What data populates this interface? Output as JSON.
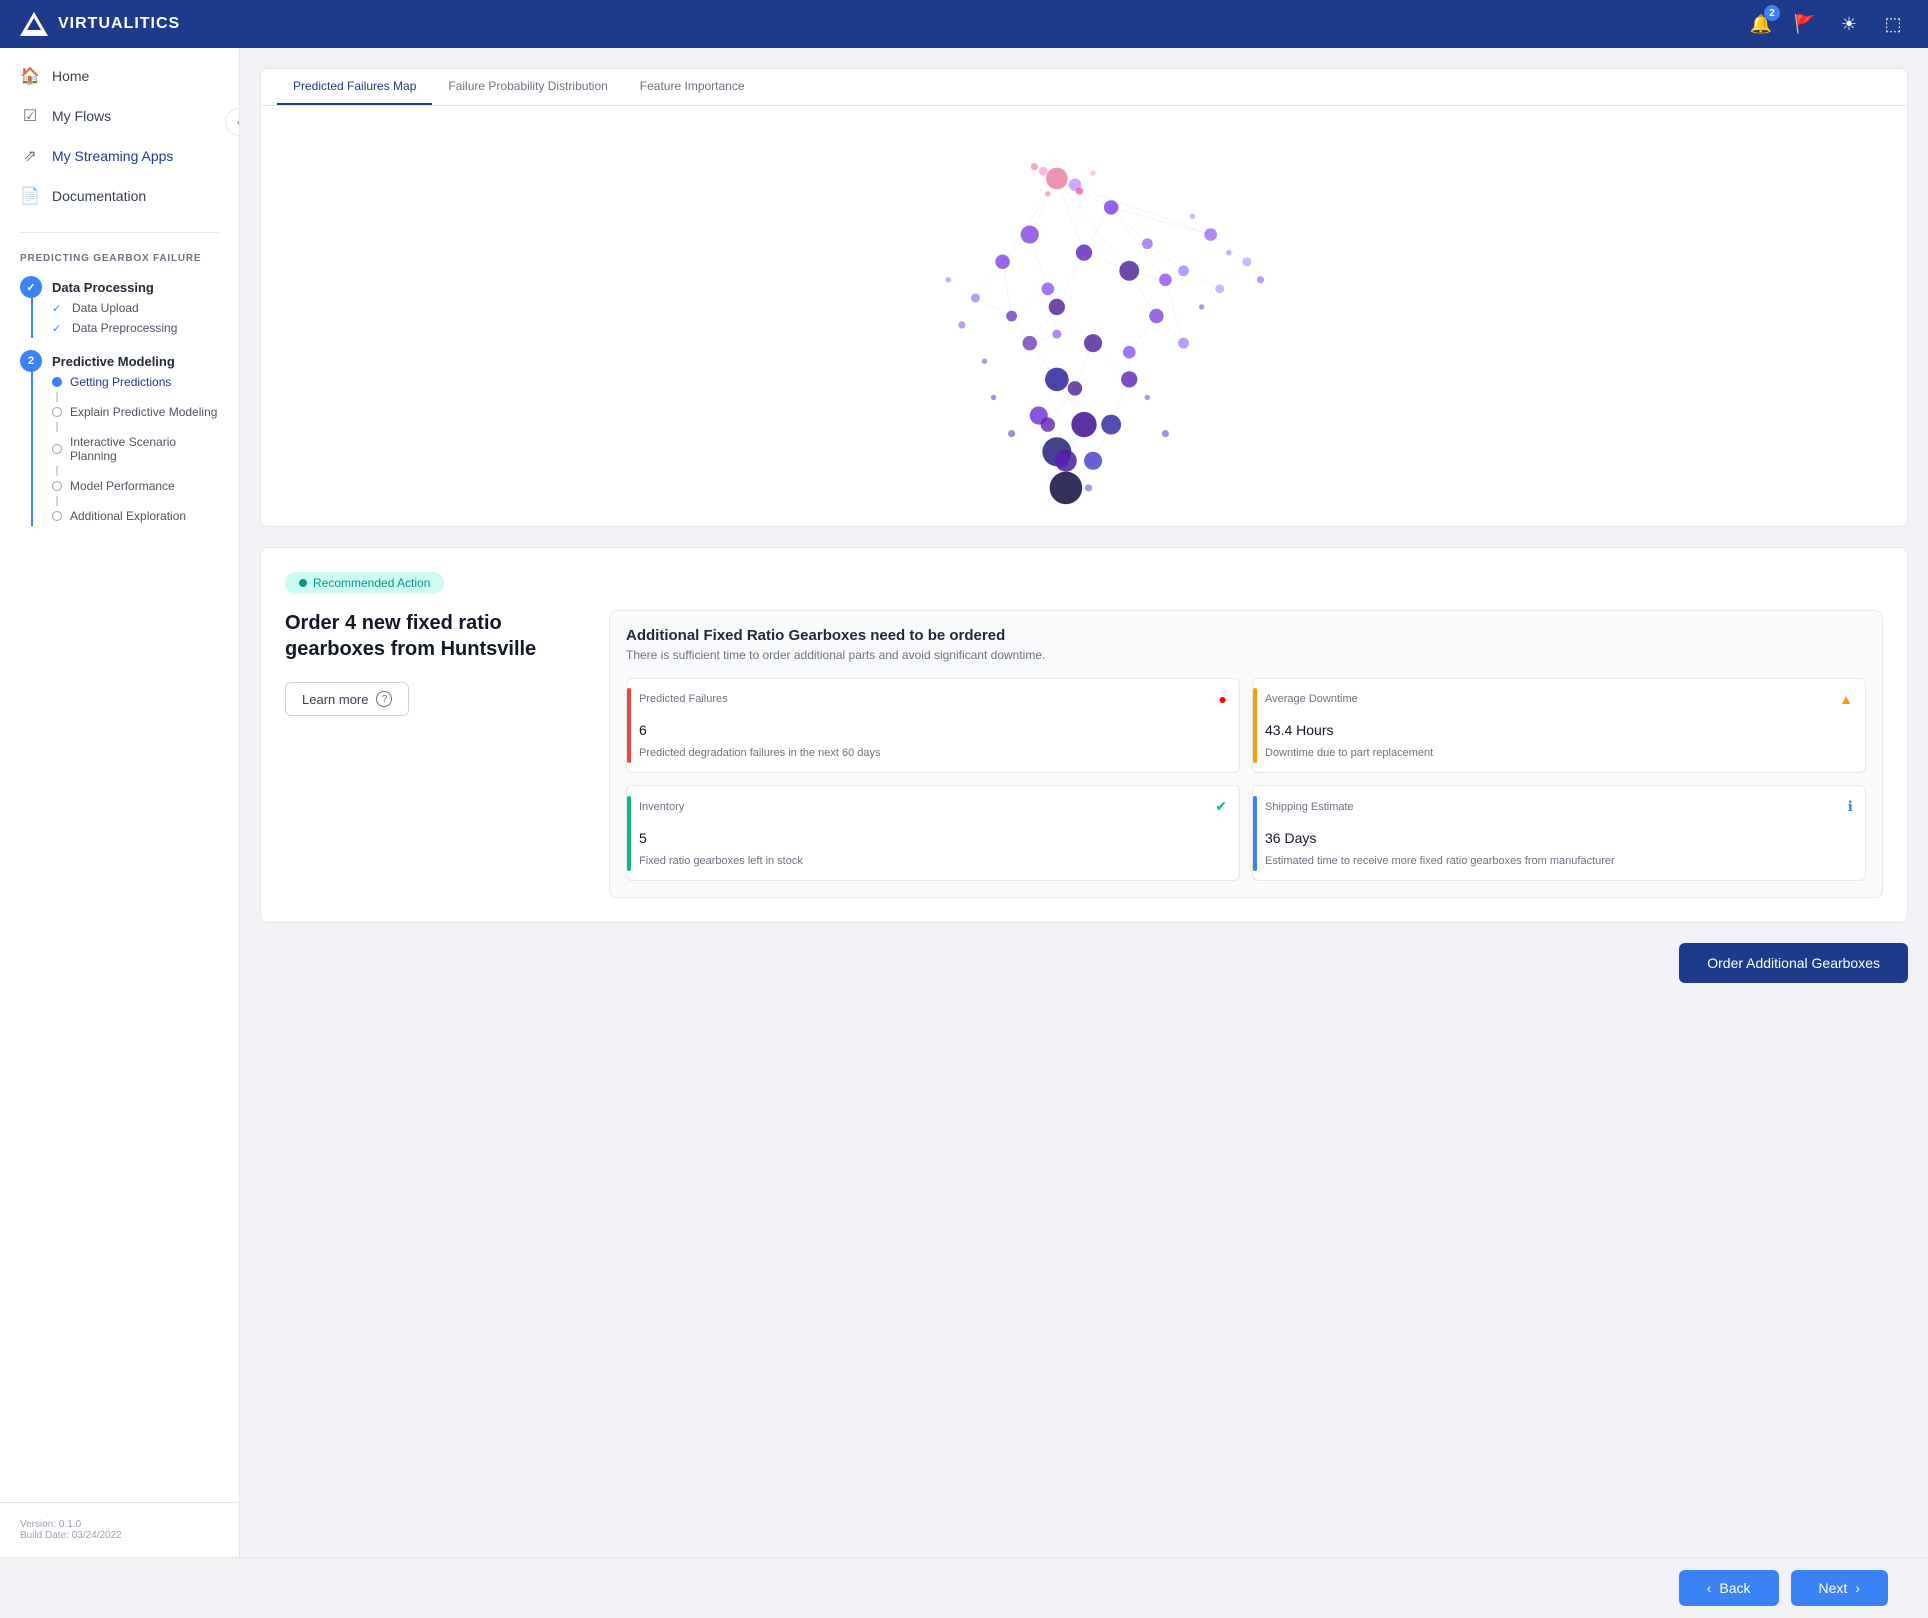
{
  "app": {
    "name": "VIRTUALITICS",
    "logo_alt": "Virtualitics logo"
  },
  "top_nav": {
    "notification_count": "2",
    "icons": [
      "bell",
      "flag",
      "theme",
      "logout"
    ]
  },
  "sidebar": {
    "nav_items": [
      {
        "label": "Home",
        "icon": "🏠",
        "active": false
      },
      {
        "label": "My Flows",
        "icon": "✔",
        "active": false
      },
      {
        "label": "My Streaming Apps",
        "icon": "↗",
        "active": true
      },
      {
        "label": "Documentation",
        "icon": "📄",
        "active": false
      }
    ],
    "section_label": "PREDICTING GEARBOX FAILURE",
    "workflow": [
      {
        "label": "Data Processing",
        "status": "completed",
        "number": "✓",
        "children": [
          {
            "label": "Data Upload",
            "status": "completed"
          },
          {
            "label": "Data Preprocessing",
            "status": "completed"
          }
        ]
      },
      {
        "label": "Predictive Modeling",
        "status": "active",
        "number": "2",
        "children": [
          {
            "label": "Getting Predictions",
            "status": "active"
          },
          {
            "label": "Explain Predictive Modeling",
            "status": "inactive"
          },
          {
            "label": "Interactive Scenario Planning",
            "status": "inactive"
          },
          {
            "label": "Model Performance",
            "status": "inactive"
          },
          {
            "label": "Additional Exploration",
            "status": "inactive"
          }
        ]
      }
    ],
    "footer": {
      "version": "Version: 0.1.0",
      "build_date": "Build Date: 03/24/2022"
    }
  },
  "graph": {
    "tabs": [
      "Predicted Failures Map",
      "Failure Probability Distribution",
      "Feature Importance"
    ],
    "active_tab": 0
  },
  "recommendation": {
    "badge_label": "Recommended Action",
    "title": "Order 4 new fixed ratio gearboxes from Huntsville",
    "learn_more_label": "Learn more",
    "panel_title": "Additional Fixed Ratio Gearboxes need to be ordered",
    "panel_subtitle": "There is sufficient time to order additional parts and avoid significant downtime.",
    "metrics": [
      {
        "label": "Predicted Failures",
        "value": "6",
        "unit": "",
        "description": "Predicted degradation failures in the next 60 days",
        "bar_color": "#ef4444",
        "icon": "🔴",
        "icon_color": "red"
      },
      {
        "label": "Average Downtime",
        "value": "43.4",
        "unit": " Hours",
        "description": "Downtime due to part replacement",
        "bar_color": "#f59e0b",
        "icon": "⚠",
        "icon_color": "orange"
      },
      {
        "label": "Inventory",
        "value": "5",
        "unit": "",
        "description": "Fixed ratio gearboxes left in stock",
        "bar_color": "#10b981",
        "icon": "✅",
        "icon_color": "green"
      },
      {
        "label": "Shipping Estimate",
        "value": "36",
        "unit": " Days",
        "description": "Estimated time to receive more fixed ratio gearboxes from manufacturer",
        "bar_color": "#3b82f6",
        "icon": "ℹ",
        "icon_color": "blue"
      }
    ]
  },
  "bottom_bar": {
    "back_label": "Back",
    "next_label": "Next",
    "order_label": "Order Additional Gearboxes"
  }
}
